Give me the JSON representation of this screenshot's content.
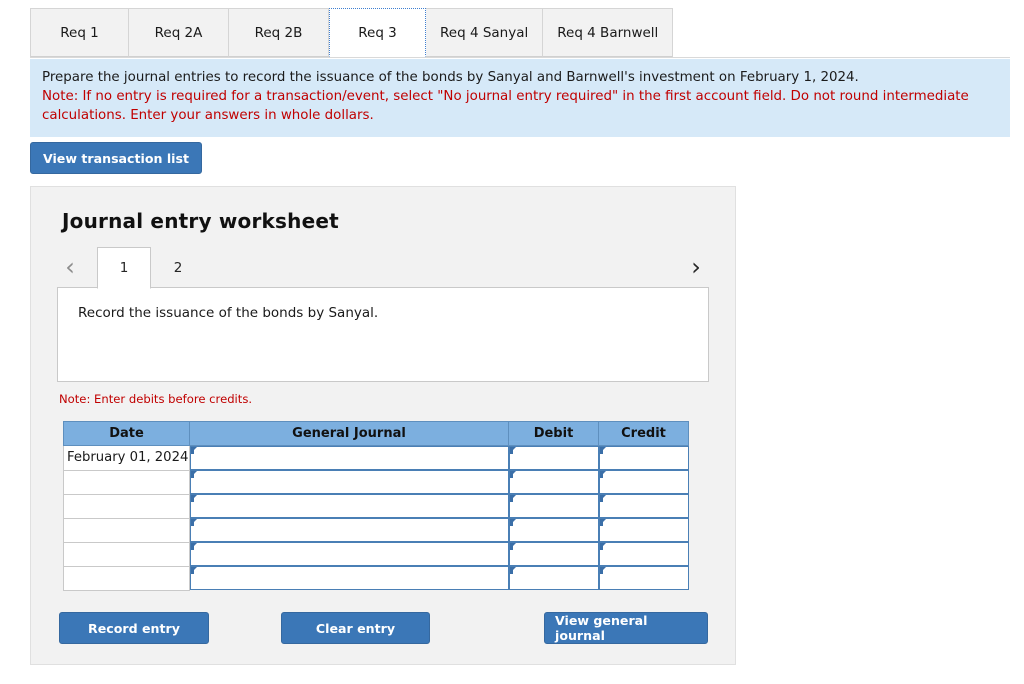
{
  "requirement_tabs": [
    {
      "label": "Req 1",
      "active": false
    },
    {
      "label": "Req 2A",
      "active": false
    },
    {
      "label": "Req 2B",
      "active": false
    },
    {
      "label": "Req 3",
      "active": true
    },
    {
      "label": "Req 4 Sanyal",
      "active": false
    },
    {
      "label": "Req 4 Barnwell",
      "active": false
    }
  ],
  "instructions": {
    "line1": "Prepare the journal entries to record the issuance of the bonds by Sanyal and Barnwell's investment on February 1, 2024.",
    "line2": "Note: If no entry is required for a transaction/event, select \"No journal entry required\" in the first account field. Do not round intermediate calculations. Enter your answers in whole dollars."
  },
  "toolbar": {
    "view_transaction_list": "View transaction list"
  },
  "worksheet": {
    "title": "Journal entry worksheet",
    "pager": {
      "prev_icon": "‹",
      "next_icon": "›",
      "pages": [
        {
          "label": "1",
          "active": true
        },
        {
          "label": "2",
          "active": false
        }
      ]
    },
    "description": "Record the issuance of the bonds by Sanyal.",
    "note": "Note: Enter debits before credits.",
    "table": {
      "headers": [
        "Date",
        "General Journal",
        "Debit",
        "Credit"
      ],
      "rows": [
        {
          "date": "February 01, 2024",
          "general_journal": "",
          "debit": "",
          "credit": ""
        },
        {
          "date": "",
          "general_journal": "",
          "debit": "",
          "credit": ""
        },
        {
          "date": "",
          "general_journal": "",
          "debit": "",
          "credit": ""
        },
        {
          "date": "",
          "general_journal": "",
          "debit": "",
          "credit": ""
        },
        {
          "date": "",
          "general_journal": "",
          "debit": "",
          "credit": ""
        },
        {
          "date": "",
          "general_journal": "",
          "debit": "",
          "credit": ""
        }
      ]
    },
    "actions": {
      "record_entry": "Record entry",
      "clear_entry": "Clear entry",
      "view_general_journal": "View general journal"
    }
  },
  "colors": {
    "primary_button": "#3b77b7",
    "table_header": "#7cafdf",
    "instruction_background": "#d6e9f8",
    "note_red": "#c00000",
    "panel_background": "#f2f2f2",
    "field_border": "#4a7fb5"
  }
}
